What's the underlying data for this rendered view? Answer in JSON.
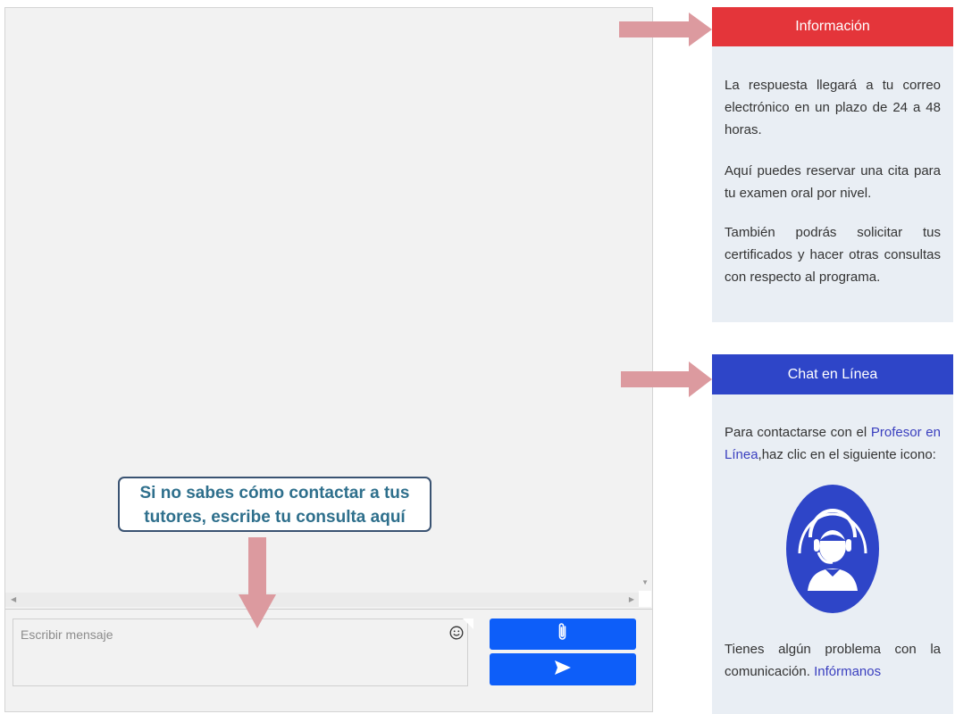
{
  "callout": {
    "line1": "Si no sabes cómo contactar a tus",
    "line2": "tutores, escribe tu consulta aquí"
  },
  "composer": {
    "placeholder": "Escribir mensaje",
    "emoji_icon": "smiley-icon",
    "attach_icon": "paperclip-icon",
    "send_icon": "send-icon"
  },
  "info": {
    "header": "Información",
    "p1": "La respuesta llegará a tu correo electrónico en un plazo de 24 a 48 horas.",
    "p2": "Aquí puedes reservar una cita para tu examen oral por nivel.",
    "p3": "También podrás solicitar tus certificados y hacer otras consultas con respecto al programa."
  },
  "chat": {
    "header": "Chat en Línea",
    "p1_before": "Para contactarse con el ",
    "p1_link": "Profesor en Línea",
    "p1_after": ",haz clic en el siguiente icono:",
    "p2_before": "Tienes algún problema con la comunicación. ",
    "p2_link": "Infórmanos",
    "support_icon": "headset-support-icon"
  },
  "colors": {
    "info_header": "#e4353a",
    "chat_header": "#2e45c8",
    "button_blue": "#0d5ef9",
    "arrow": "#dc9a9f",
    "callout_text": "#2e6f8c"
  }
}
